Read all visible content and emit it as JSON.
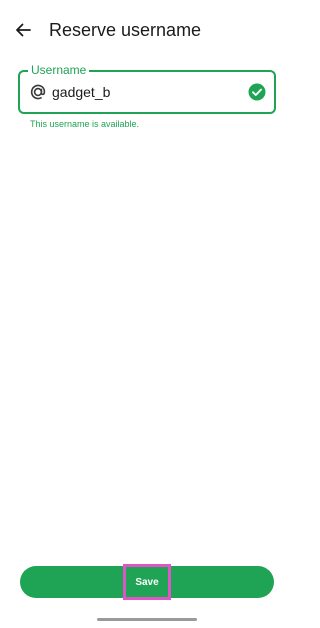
{
  "app_bar": {
    "back_icon": "arrow-left-icon",
    "title": "Reserve username"
  },
  "username_field": {
    "label": "Username",
    "prefix_icon": "at-sign-icon",
    "value": "gadget_b",
    "status_icon": "check-circle-icon",
    "helper_text": "This username is available."
  },
  "footer": {
    "save_label": "Save"
  },
  "colors": {
    "accent": "#1fa455",
    "highlight": "#e055c6",
    "text": "#1b1b1b",
    "background": "#ffffff",
    "nav_handle": "#9a9a9a"
  }
}
